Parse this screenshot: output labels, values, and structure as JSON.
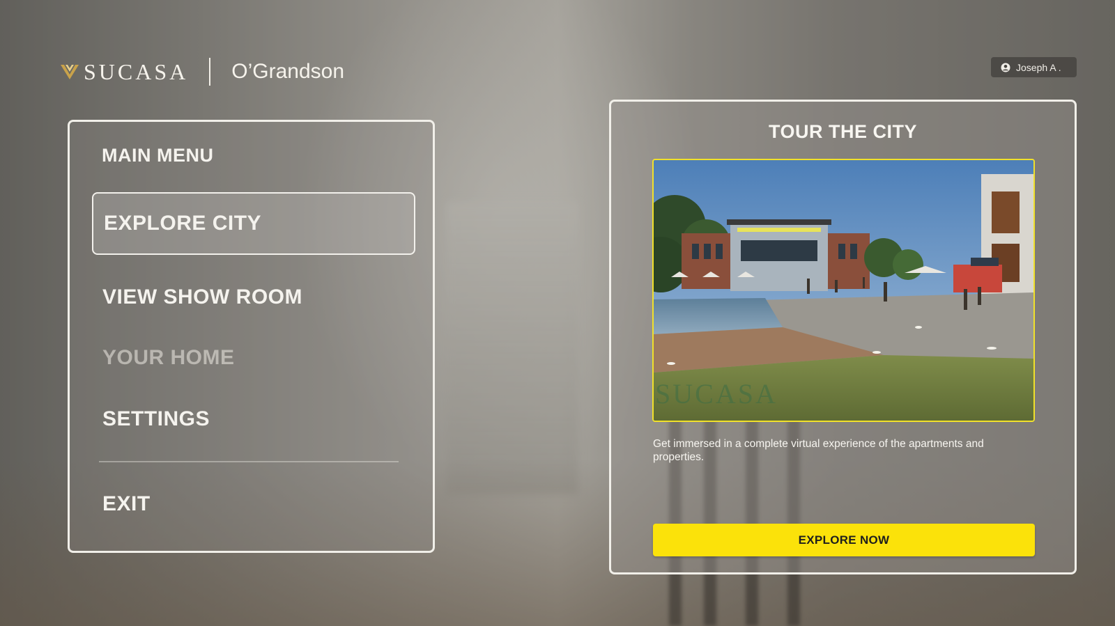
{
  "header": {
    "brand_name": "SUCASA",
    "project_name": "O’Grandson",
    "user_name": "Joseph A .",
    "user_icon": "user-circle-icon",
    "brand_icon": "sucasa-chevron-logo-icon"
  },
  "menu": {
    "title": "MAIN MENU",
    "items": [
      {
        "label": "EXPLORE CITY",
        "state": "selected"
      },
      {
        "label": "VIEW SHOW ROOM",
        "state": "normal"
      },
      {
        "label": "YOUR HOME",
        "state": "disabled"
      },
      {
        "label": "SETTINGS",
        "state": "normal"
      }
    ],
    "exit_label": "EXIT"
  },
  "tour": {
    "title": "TOUR THE CITY",
    "image_watermark": "SUCASA",
    "description": "Get immersed in a complete virtual experience of the apartments and properties.",
    "button_label": "EXPLORE NOW"
  },
  "colors": {
    "accent": "#fbe20a",
    "panel_border": "#f1efe9",
    "text": "#f5f3ee",
    "image_border": "#f1e12a"
  }
}
